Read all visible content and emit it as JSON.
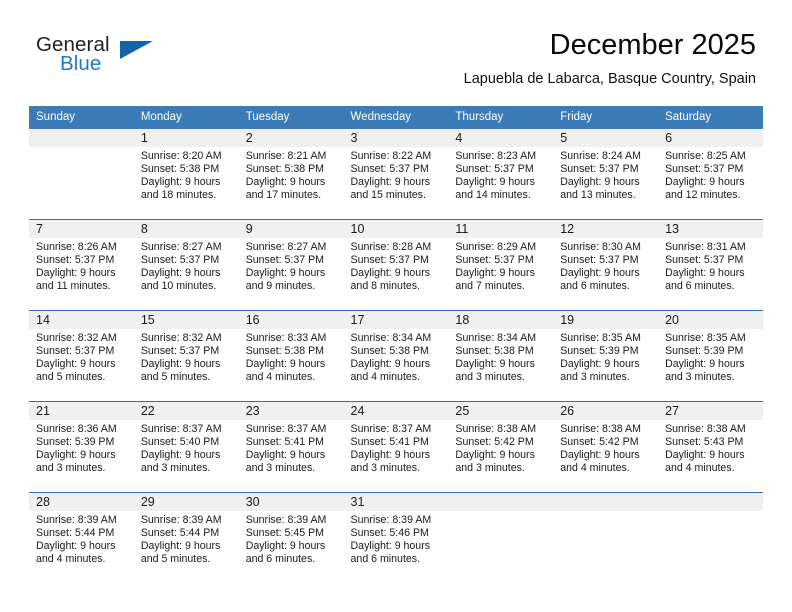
{
  "brand": {
    "name_part1": "General",
    "name_part2": "Blue",
    "logo_icon": "triangle-logo-icon",
    "accent_color": "#1263a8"
  },
  "header": {
    "month_title": "December 2025",
    "location": "Lapuebla de Labarca, Basque Country, Spain"
  },
  "calendar": {
    "header_bg_color": "#3b7cb8",
    "daynum_band_color": "#f0f0f0",
    "weekday_headers": [
      "Sunday",
      "Monday",
      "Tuesday",
      "Wednesday",
      "Thursday",
      "Friday",
      "Saturday"
    ],
    "weeks": [
      [
        {
          "day": "",
          "sunrise": "",
          "sunset": "",
          "daylight_line1": "",
          "daylight_line2": "",
          "empty": true
        },
        {
          "day": "1",
          "sunrise": "Sunrise: 8:20 AM",
          "sunset": "Sunset: 5:38 PM",
          "daylight_line1": "Daylight: 9 hours",
          "daylight_line2": "and 18 minutes."
        },
        {
          "day": "2",
          "sunrise": "Sunrise: 8:21 AM",
          "sunset": "Sunset: 5:38 PM",
          "daylight_line1": "Daylight: 9 hours",
          "daylight_line2": "and 17 minutes."
        },
        {
          "day": "3",
          "sunrise": "Sunrise: 8:22 AM",
          "sunset": "Sunset: 5:37 PM",
          "daylight_line1": "Daylight: 9 hours",
          "daylight_line2": "and 15 minutes."
        },
        {
          "day": "4",
          "sunrise": "Sunrise: 8:23 AM",
          "sunset": "Sunset: 5:37 PM",
          "daylight_line1": "Daylight: 9 hours",
          "daylight_line2": "and 14 minutes."
        },
        {
          "day": "5",
          "sunrise": "Sunrise: 8:24 AM",
          "sunset": "Sunset: 5:37 PM",
          "daylight_line1": "Daylight: 9 hours",
          "daylight_line2": "and 13 minutes."
        },
        {
          "day": "6",
          "sunrise": "Sunrise: 8:25 AM",
          "sunset": "Sunset: 5:37 PM",
          "daylight_line1": "Daylight: 9 hours",
          "daylight_line2": "and 12 minutes."
        }
      ],
      [
        {
          "day": "7",
          "sunrise": "Sunrise: 8:26 AM",
          "sunset": "Sunset: 5:37 PM",
          "daylight_line1": "Daylight: 9 hours",
          "daylight_line2": "and 11 minutes."
        },
        {
          "day": "8",
          "sunrise": "Sunrise: 8:27 AM",
          "sunset": "Sunset: 5:37 PM",
          "daylight_line1": "Daylight: 9 hours",
          "daylight_line2": "and 10 minutes."
        },
        {
          "day": "9",
          "sunrise": "Sunrise: 8:27 AM",
          "sunset": "Sunset: 5:37 PM",
          "daylight_line1": "Daylight: 9 hours",
          "daylight_line2": "and 9 minutes."
        },
        {
          "day": "10",
          "sunrise": "Sunrise: 8:28 AM",
          "sunset": "Sunset: 5:37 PM",
          "daylight_line1": "Daylight: 9 hours",
          "daylight_line2": "and 8 minutes."
        },
        {
          "day": "11",
          "sunrise": "Sunrise: 8:29 AM",
          "sunset": "Sunset: 5:37 PM",
          "daylight_line1": "Daylight: 9 hours",
          "daylight_line2": "and 7 minutes."
        },
        {
          "day": "12",
          "sunrise": "Sunrise: 8:30 AM",
          "sunset": "Sunset: 5:37 PM",
          "daylight_line1": "Daylight: 9 hours",
          "daylight_line2": "and 6 minutes."
        },
        {
          "day": "13",
          "sunrise": "Sunrise: 8:31 AM",
          "sunset": "Sunset: 5:37 PM",
          "daylight_line1": "Daylight: 9 hours",
          "daylight_line2": "and 6 minutes."
        }
      ],
      [
        {
          "day": "14",
          "sunrise": "Sunrise: 8:32 AM",
          "sunset": "Sunset: 5:37 PM",
          "daylight_line1": "Daylight: 9 hours",
          "daylight_line2": "and 5 minutes."
        },
        {
          "day": "15",
          "sunrise": "Sunrise: 8:32 AM",
          "sunset": "Sunset: 5:37 PM",
          "daylight_line1": "Daylight: 9 hours",
          "daylight_line2": "and 5 minutes."
        },
        {
          "day": "16",
          "sunrise": "Sunrise: 8:33 AM",
          "sunset": "Sunset: 5:38 PM",
          "daylight_line1": "Daylight: 9 hours",
          "daylight_line2": "and 4 minutes."
        },
        {
          "day": "17",
          "sunrise": "Sunrise: 8:34 AM",
          "sunset": "Sunset: 5:38 PM",
          "daylight_line1": "Daylight: 9 hours",
          "daylight_line2": "and 4 minutes."
        },
        {
          "day": "18",
          "sunrise": "Sunrise: 8:34 AM",
          "sunset": "Sunset: 5:38 PM",
          "daylight_line1": "Daylight: 9 hours",
          "daylight_line2": "and 3 minutes."
        },
        {
          "day": "19",
          "sunrise": "Sunrise: 8:35 AM",
          "sunset": "Sunset: 5:39 PM",
          "daylight_line1": "Daylight: 9 hours",
          "daylight_line2": "and 3 minutes."
        },
        {
          "day": "20",
          "sunrise": "Sunrise: 8:35 AM",
          "sunset": "Sunset: 5:39 PM",
          "daylight_line1": "Daylight: 9 hours",
          "daylight_line2": "and 3 minutes."
        }
      ],
      [
        {
          "day": "21",
          "sunrise": "Sunrise: 8:36 AM",
          "sunset": "Sunset: 5:39 PM",
          "daylight_line1": "Daylight: 9 hours",
          "daylight_line2": "and 3 minutes."
        },
        {
          "day": "22",
          "sunrise": "Sunrise: 8:37 AM",
          "sunset": "Sunset: 5:40 PM",
          "daylight_line1": "Daylight: 9 hours",
          "daylight_line2": "and 3 minutes."
        },
        {
          "day": "23",
          "sunrise": "Sunrise: 8:37 AM",
          "sunset": "Sunset: 5:41 PM",
          "daylight_line1": "Daylight: 9 hours",
          "daylight_line2": "and 3 minutes."
        },
        {
          "day": "24",
          "sunrise": "Sunrise: 8:37 AM",
          "sunset": "Sunset: 5:41 PM",
          "daylight_line1": "Daylight: 9 hours",
          "daylight_line2": "and 3 minutes."
        },
        {
          "day": "25",
          "sunrise": "Sunrise: 8:38 AM",
          "sunset": "Sunset: 5:42 PM",
          "daylight_line1": "Daylight: 9 hours",
          "daylight_line2": "and 3 minutes."
        },
        {
          "day": "26",
          "sunrise": "Sunrise: 8:38 AM",
          "sunset": "Sunset: 5:42 PM",
          "daylight_line1": "Daylight: 9 hours",
          "daylight_line2": "and 4 minutes."
        },
        {
          "day": "27",
          "sunrise": "Sunrise: 8:38 AM",
          "sunset": "Sunset: 5:43 PM",
          "daylight_line1": "Daylight: 9 hours",
          "daylight_line2": "and 4 minutes."
        }
      ],
      [
        {
          "day": "28",
          "sunrise": "Sunrise: 8:39 AM",
          "sunset": "Sunset: 5:44 PM",
          "daylight_line1": "Daylight: 9 hours",
          "daylight_line2": "and 4 minutes."
        },
        {
          "day": "29",
          "sunrise": "Sunrise: 8:39 AM",
          "sunset": "Sunset: 5:44 PM",
          "daylight_line1": "Daylight: 9 hours",
          "daylight_line2": "and 5 minutes."
        },
        {
          "day": "30",
          "sunrise": "Sunrise: 8:39 AM",
          "sunset": "Sunset: 5:45 PM",
          "daylight_line1": "Daylight: 9 hours",
          "daylight_line2": "and 6 minutes."
        },
        {
          "day": "31",
          "sunrise": "Sunrise: 8:39 AM",
          "sunset": "Sunset: 5:46 PM",
          "daylight_line1": "Daylight: 9 hours",
          "daylight_line2": "and 6 minutes."
        },
        {
          "day": "",
          "sunrise": "",
          "sunset": "",
          "daylight_line1": "",
          "daylight_line2": "",
          "empty": true
        },
        {
          "day": "",
          "sunrise": "",
          "sunset": "",
          "daylight_line1": "",
          "daylight_line2": "",
          "empty": true
        },
        {
          "day": "",
          "sunrise": "",
          "sunset": "",
          "daylight_line1": "",
          "daylight_line2": "",
          "empty": true
        }
      ]
    ]
  }
}
